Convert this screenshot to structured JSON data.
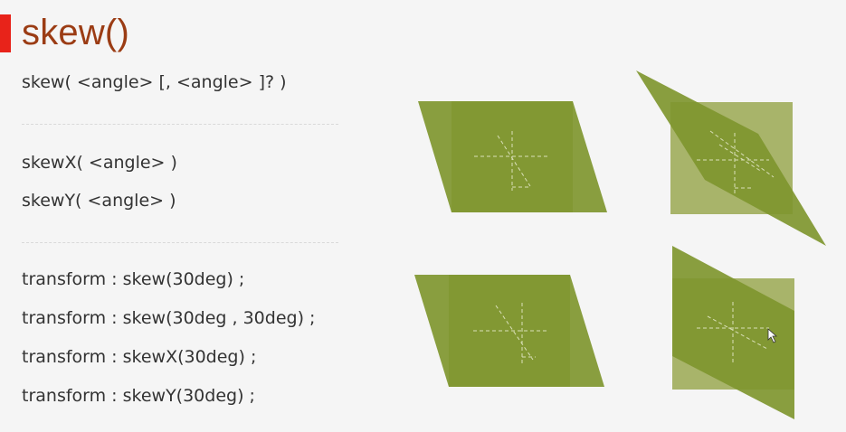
{
  "slide": {
    "title": "skew()",
    "accent_color": "#e8231a",
    "title_color": "#9b3c14",
    "syntax": {
      "skew": "skew( <angle> [, <angle> ]? )",
      "skewX": "skewX( <angle> )",
      "skewY": "skewY( <angle> )"
    },
    "examples": [
      "transform : skew(30deg) ;",
      "transform : skew(30deg , 30deg) ;",
      "transform : skewX(30deg) ;",
      "transform : skewY(30deg) ;"
    ]
  },
  "figures": {
    "original_color": "#a8b46a",
    "skewed_color": "#7f962f",
    "guide_color": "#d9dfb8"
  }
}
